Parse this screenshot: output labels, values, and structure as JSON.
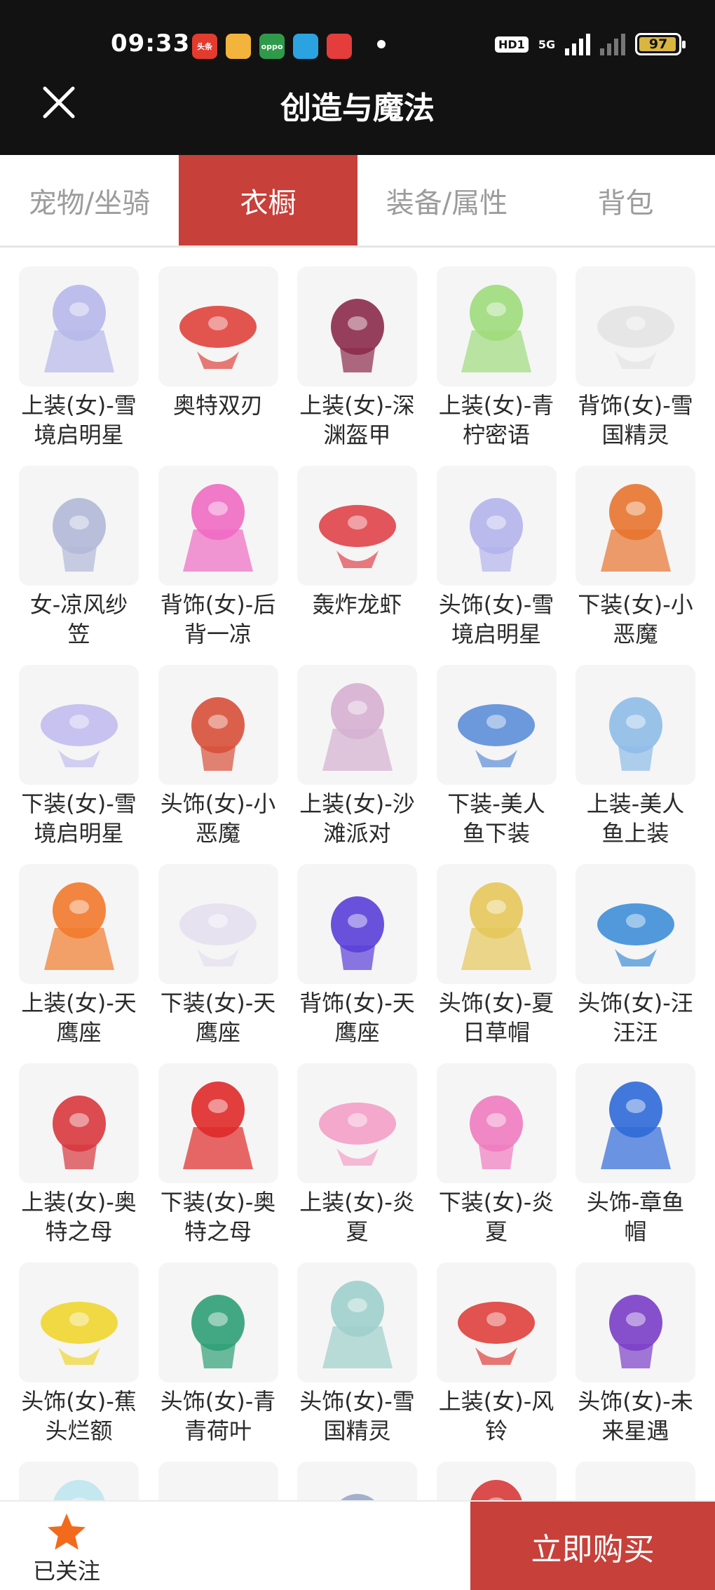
{
  "status_bar": {
    "time": "09:33",
    "app_icons": [
      {
        "name": "toutiao-icon",
        "label": "头条",
        "color": "#e33b2e"
      },
      {
        "name": "sunglasses-app-icon",
        "label": "",
        "color": "#f2b43a"
      },
      {
        "name": "oppo-store-icon",
        "label": "oppo",
        "color": "#2f9a4a"
      },
      {
        "name": "telegram-icon",
        "label": "",
        "color": "#2aa3e0"
      },
      {
        "name": "weibo-icon",
        "label": "",
        "color": "#e53c3c"
      }
    ],
    "hd_label": "HD1",
    "network_label": "5G",
    "battery": "97"
  },
  "header": {
    "title": "创造与魔法",
    "close_icon": "close-icon"
  },
  "tabs": [
    {
      "label": "宠物/坐骑",
      "active": false
    },
    {
      "label": "衣橱",
      "active": true
    },
    {
      "label": "装备/属性",
      "active": false
    },
    {
      "label": "背包",
      "active": false
    }
  ],
  "items": [
    {
      "name": "上装(女)-雪境启明星",
      "color": "#b7b8ea"
    },
    {
      "name": "奥特双刃",
      "color": "#e0443d"
    },
    {
      "name": "上装(女)-深渊盔甲",
      "color": "#8c2b4b"
    },
    {
      "name": "上装(女)-青柠密语",
      "color": "#9fdc7c"
    },
    {
      "name": "背饰(女)-雪国精灵",
      "color": "#e4e4e4"
    },
    {
      "name": "女-凉风纱笠",
      "color": "#b3b9d8"
    },
    {
      "name": "背饰(女)-后背一凉",
      "color": "#f06bc3"
    },
    {
      "name": "轰炸龙虾",
      "color": "#e0444a"
    },
    {
      "name": "头饰(女)-雪境启明星",
      "color": "#b4b4ec"
    },
    {
      "name": "下装(女)-小恶魔",
      "color": "#e8742f"
    },
    {
      "name": "下装(女)-雪境启明星",
      "color": "#c3bdf0"
    },
    {
      "name": "头饰(女)-小恶魔",
      "color": "#d8503a"
    },
    {
      "name": "上装(女)-沙滩派对",
      "color": "#d6b0d2"
    },
    {
      "name": "下装-美人鱼下装",
      "color": "#5d8fd8"
    },
    {
      "name": "上装-美人鱼上装",
      "color": "#8fbce8"
    },
    {
      "name": "上装(女)-天鹰座",
      "color": "#f27a2c"
    },
    {
      "name": "下装(女)-天鹰座",
      "color": "#e4e0f0"
    },
    {
      "name": "背饰(女)-天鹰座",
      "color": "#5a3fd8"
    },
    {
      "name": "头饰(女)-夏日草帽",
      "color": "#e6c85a"
    },
    {
      "name": "头饰(女)-汪汪汪",
      "color": "#3f8fd8"
    },
    {
      "name": "上装(女)-奥特之母",
      "color": "#d8383e"
    },
    {
      "name": "下装(女)-奥特之母",
      "color": "#e02a2a"
    },
    {
      "name": "上装(女)-炎夏",
      "color": "#f3a0c8"
    },
    {
      "name": "下装(女)-炎夏",
      "color": "#f07cc0"
    },
    {
      "name": "头饰-章鱼帽",
      "color": "#2f6ad8"
    },
    {
      "name": "头饰(女)-蕉头烂额",
      "color": "#f0d630"
    },
    {
      "name": "头饰(女)-青青荷叶",
      "color": "#2fa078"
    },
    {
      "name": "头饰(女)-雪国精灵",
      "color": "#9fd0cc"
    },
    {
      "name": "上装(女)-风铃",
      "color": "#e0403c"
    },
    {
      "name": "头饰(女)-未来星遇",
      "color": "#7a3ec8"
    }
  ],
  "partial_row_colors": [
    "#bfe6f0",
    "#3b3f9c",
    "#9aa8c8",
    "#d83a3a",
    "#3fa64a"
  ],
  "bottom_bar": {
    "follow_label": "已关注",
    "follow_icon": "star-icon",
    "buy_label": "立即购买"
  },
  "colors": {
    "accent": "#c7403a",
    "star": "#f26a1b"
  }
}
